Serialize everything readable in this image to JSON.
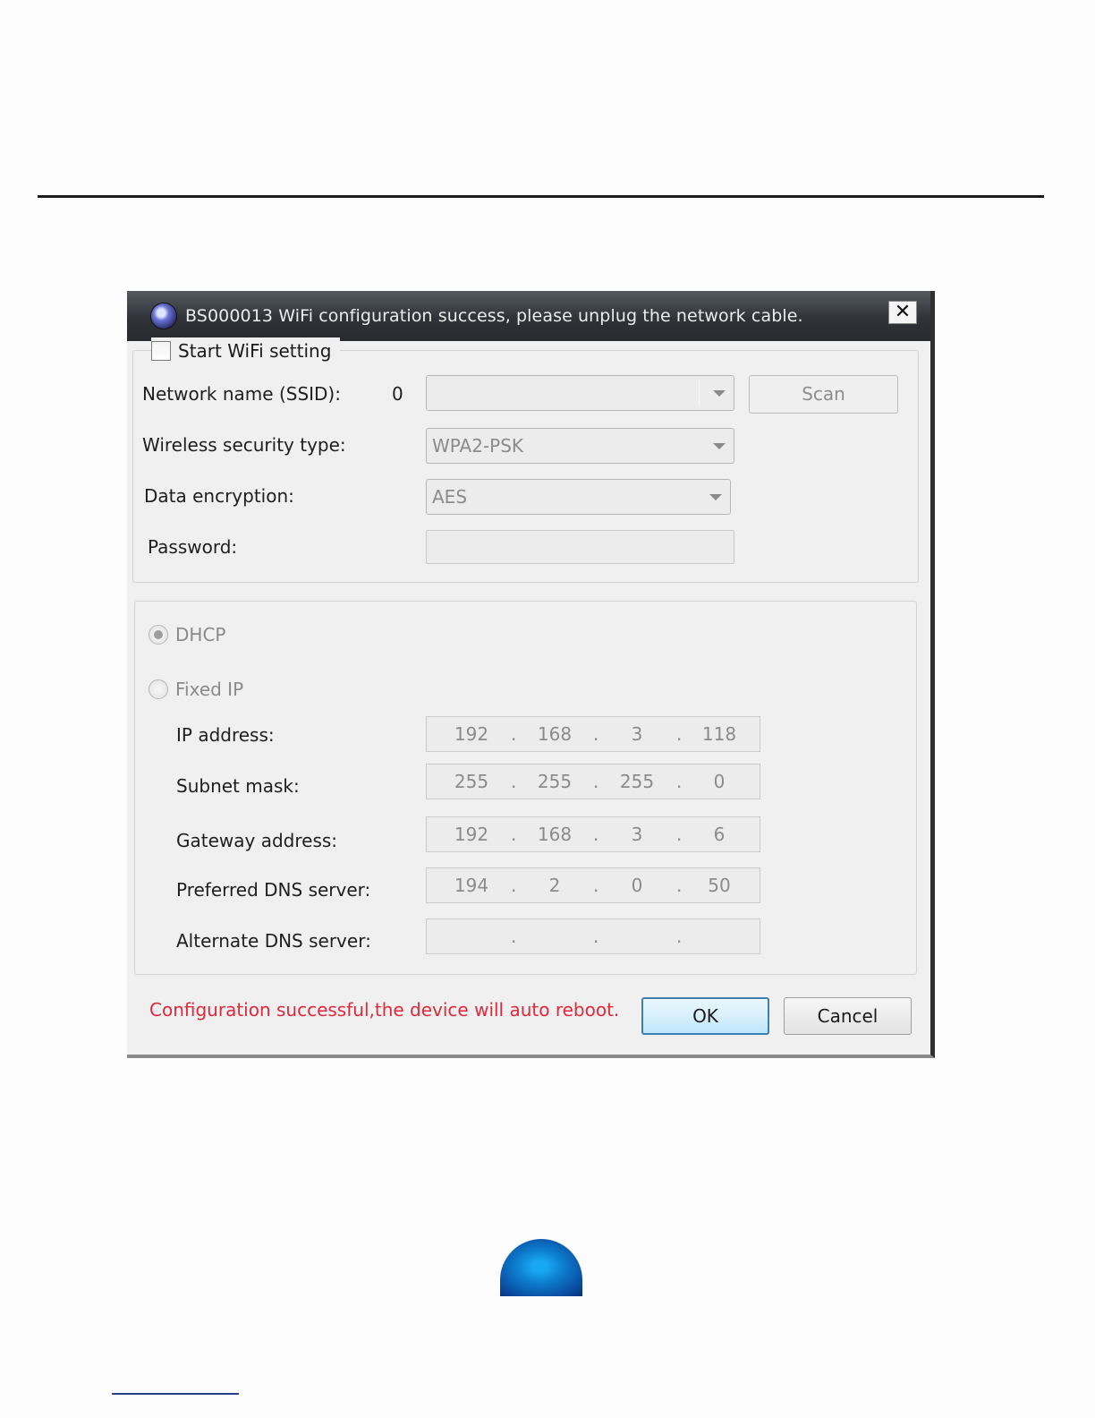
{
  "window": {
    "title": "BS000013  WiFi configuration success, please unplug the network cable.",
    "close_symbol": "✕"
  },
  "wifi_group": {
    "start_wifi_label": "Start WiFi setting",
    "start_wifi_checked": false,
    "ssid_label": "Network name (SSID):",
    "ssid_count": "0",
    "ssid_value": "",
    "scan_label": "Scan",
    "security_label": "Wireless security type:",
    "security_value": "WPA2-PSK",
    "encryption_label": "Data encryption:",
    "encryption_value": "AES",
    "password_label": "Password:",
    "password_value": ""
  },
  "ip_group": {
    "dhcp_label": "DHCP",
    "dhcp_selected": true,
    "fixed_ip_label": "Fixed IP",
    "fields": [
      {
        "label": "IP address:",
        "octets": [
          "192",
          "168",
          "3",
          "118"
        ]
      },
      {
        "label": "Subnet mask:",
        "octets": [
          "255",
          "255",
          "255",
          "0"
        ]
      },
      {
        "label": "Gateway address:",
        "octets": [
          "192",
          "168",
          "3",
          "6"
        ]
      },
      {
        "label": "Preferred DNS server:",
        "octets": [
          "194",
          "2",
          "0",
          "50"
        ]
      },
      {
        "label": "Alternate DNS server:",
        "octets": [
          "",
          "",
          "",
          ""
        ]
      }
    ]
  },
  "footer": {
    "status_message": "Configuration successful,the device will auto reboot.",
    "ok_label": "OK",
    "cancel_label": "Cancel"
  },
  "colors": {
    "status_message": "#e0283a",
    "titlebar": "#2f3338",
    "logo": "#0d7ccc"
  }
}
